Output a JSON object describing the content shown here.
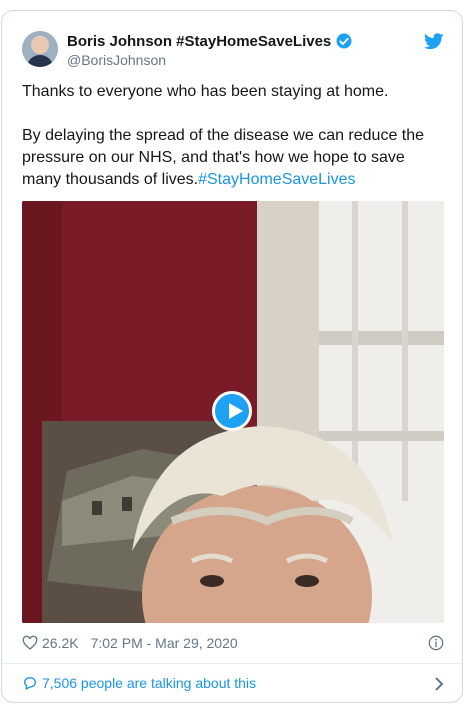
{
  "tweet": {
    "author_name": "Boris Johnson #StayHomeSaveLives",
    "handle": "@BorisJohnson",
    "text_line1": "Thanks to everyone who has been staying at home.",
    "text_line2": "By delaying the spread of the disease we can reduce the pressure on our NHS, and that's how we hope to save many thousands of lives.",
    "hashtag": "#StayHomeSaveLives",
    "likes": "26.2K",
    "timestamp": "7:02 PM - Mar 29, 2020",
    "talking": "7,506 people are talking about this"
  },
  "icons": {
    "verified": "verified-badge-icon",
    "brand": "twitter-bird-icon",
    "like": "heart-icon",
    "info": "info-icon",
    "reply": "speech-bubble-icon",
    "more": "chevron-right-icon"
  },
  "colors": {
    "accent": "#1da1f2",
    "link": "#1b95e0",
    "text": "#14171a",
    "muted": "#657786",
    "border": "#cfd9de"
  }
}
